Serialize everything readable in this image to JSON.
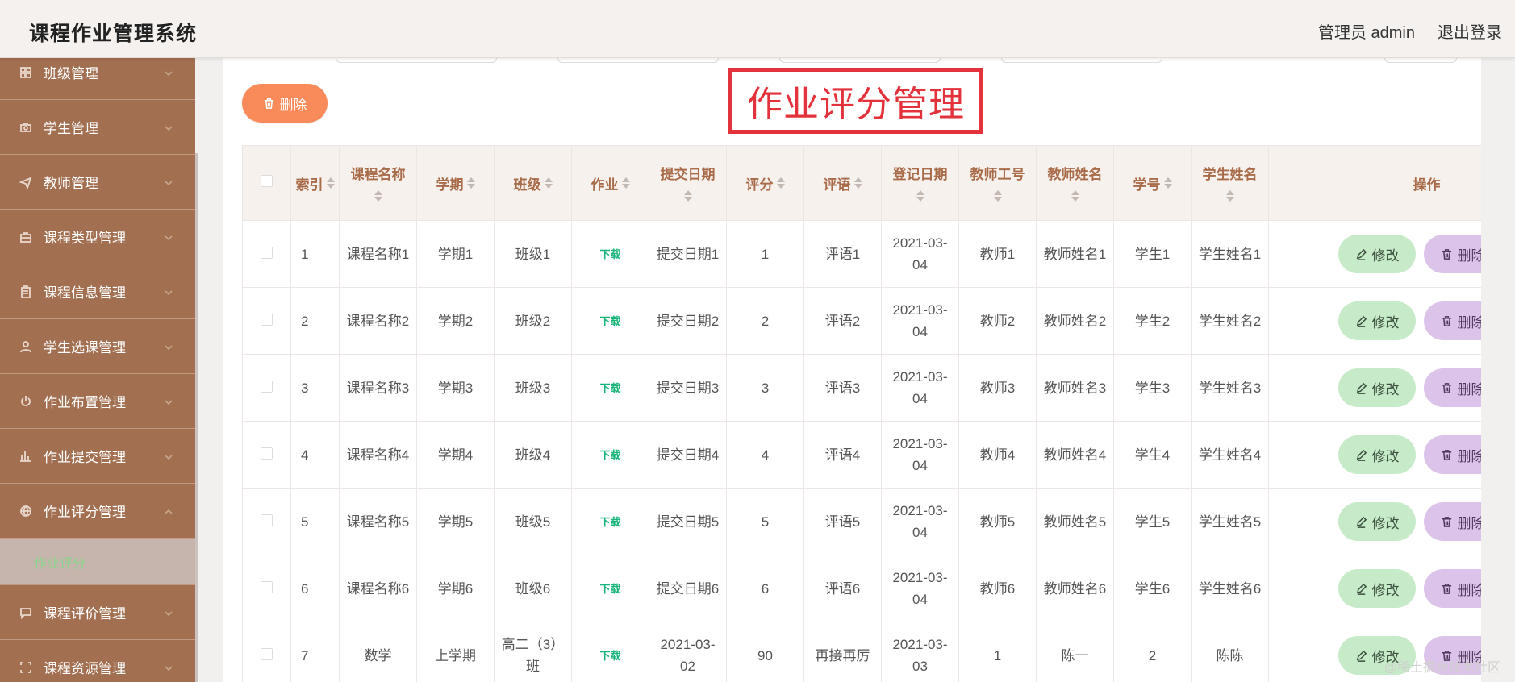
{
  "header": {
    "title": "课程作业管理系统",
    "user_label": "管理员 admin",
    "logout_label": "退出登录"
  },
  "sidebar": {
    "items": [
      {
        "label": "班级管理",
        "icon": "grid-icon"
      },
      {
        "label": "学生管理",
        "icon": "camera-icon"
      },
      {
        "label": "教师管理",
        "icon": "send-icon"
      },
      {
        "label": "课程类型管理",
        "icon": "briefcase-icon"
      },
      {
        "label": "课程信息管理",
        "icon": "clipboard-icon"
      },
      {
        "label": "学生选课管理",
        "icon": "user-icon"
      },
      {
        "label": "作业布置管理",
        "icon": "power-icon"
      },
      {
        "label": "作业提交管理",
        "icon": "bar-chart-icon"
      },
      {
        "label": "作业评分管理",
        "icon": "globe-icon",
        "expanded": true
      },
      {
        "label": "课程评价管理",
        "icon": "chat-icon"
      },
      {
        "label": "课程资源管理",
        "icon": "frame-icon"
      }
    ],
    "submenu": {
      "label": "作业评分"
    }
  },
  "toolbar": {
    "delete_label": "删除"
  },
  "page_title": "作业评分管理",
  "table": {
    "columns": [
      "索引",
      "课程名称",
      "学期",
      "班级",
      "作业",
      "提交日期",
      "评分",
      "评语",
      "登记日期",
      "教师工号",
      "教师姓名",
      "学号",
      "学生姓名",
      "操作"
    ],
    "edit_label": "修改",
    "delete_label": "删除",
    "rows": [
      {
        "index": "1",
        "course": "课程名称1",
        "term": "学期1",
        "class": "班级1",
        "homework": "下载",
        "submit_date": "提交日期1",
        "score": "1",
        "comment": "评语1",
        "reg_date": "2021-03-04",
        "teacher_no": "教师1",
        "teacher_name": "教师姓名1",
        "student_no": "学生1",
        "student_name": "学生姓名1"
      },
      {
        "index": "2",
        "course": "课程名称2",
        "term": "学期2",
        "class": "班级2",
        "homework": "下载",
        "submit_date": "提交日期2",
        "score": "2",
        "comment": "评语2",
        "reg_date": "2021-03-04",
        "teacher_no": "教师2",
        "teacher_name": "教师姓名2",
        "student_no": "学生2",
        "student_name": "学生姓名2"
      },
      {
        "index": "3",
        "course": "课程名称3",
        "term": "学期3",
        "class": "班级3",
        "homework": "下载",
        "submit_date": "提交日期3",
        "score": "3",
        "comment": "评语3",
        "reg_date": "2021-03-04",
        "teacher_no": "教师3",
        "teacher_name": "教师姓名3",
        "student_no": "学生3",
        "student_name": "学生姓名3"
      },
      {
        "index": "4",
        "course": "课程名称4",
        "term": "学期4",
        "class": "班级4",
        "homework": "下载",
        "submit_date": "提交日期4",
        "score": "4",
        "comment": "评语4",
        "reg_date": "2021-03-04",
        "teacher_no": "教师4",
        "teacher_name": "教师姓名4",
        "student_no": "学生4",
        "student_name": "学生姓名4"
      },
      {
        "index": "5",
        "course": "课程名称5",
        "term": "学期5",
        "class": "班级5",
        "homework": "下载",
        "submit_date": "提交日期5",
        "score": "5",
        "comment": "评语5",
        "reg_date": "2021-03-04",
        "teacher_no": "教师5",
        "teacher_name": "教师姓名5",
        "student_no": "学生5",
        "student_name": "学生姓名5"
      },
      {
        "index": "6",
        "course": "课程名称6",
        "term": "学期6",
        "class": "班级6",
        "homework": "下载",
        "submit_date": "提交日期6",
        "score": "6",
        "comment": "评语6",
        "reg_date": "2021-03-04",
        "teacher_no": "教师6",
        "teacher_name": "教师姓名6",
        "student_no": "学生6",
        "student_name": "学生姓名6"
      },
      {
        "index": "7",
        "course": "数学",
        "term": "上学期",
        "class": "高二（3）班",
        "homework": "下载",
        "submit_date": "2021-03-02",
        "score": "90",
        "comment": "再接再厉",
        "reg_date": "2021-03-03",
        "teacher_no": "1",
        "teacher_name": "陈一",
        "student_no": "2",
        "student_name": "陈陈"
      }
    ]
  },
  "watermark": "@稀土掘金技术社区",
  "colors": {
    "sidebar_bg": "#a26f51",
    "delete_button": "#f98a5a",
    "title_red": "#e3323b",
    "header_text": "#a96c4a",
    "edit_button": "#c7ebc9",
    "row_delete_button": "#dcc3ea",
    "download_link": "#19b47a"
  }
}
